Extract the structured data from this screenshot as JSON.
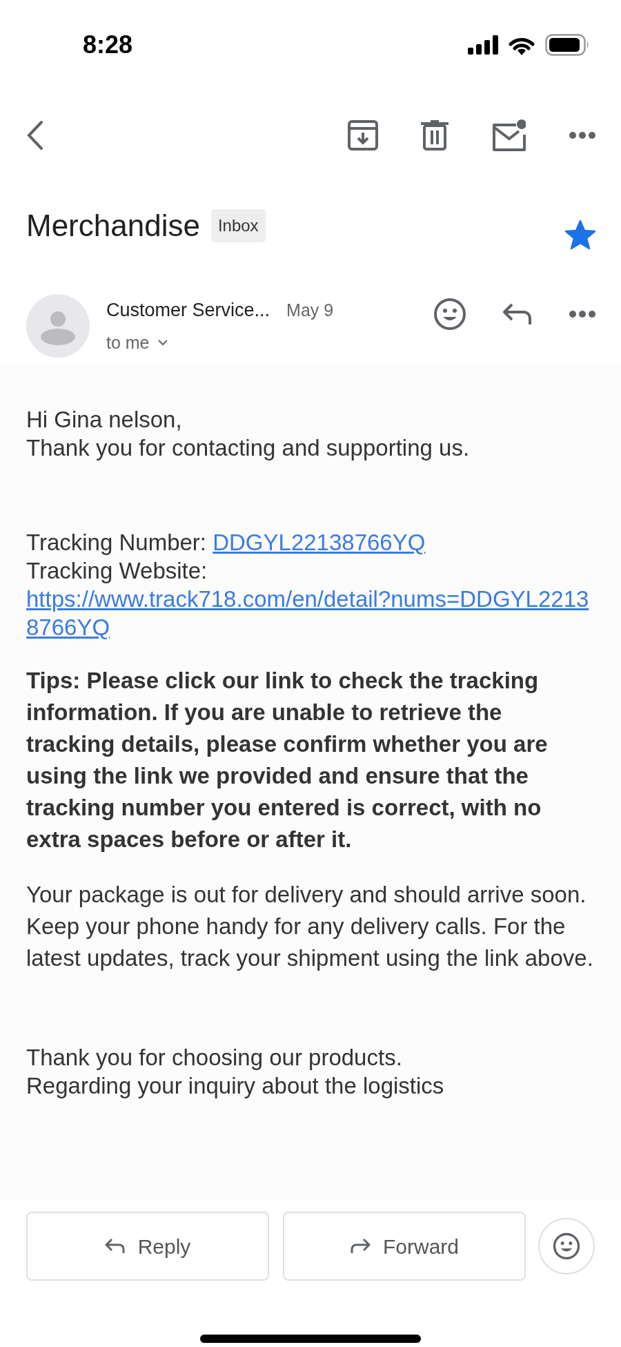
{
  "status_bar": {
    "time": "8:28"
  },
  "subject": {
    "title": "Merchandise",
    "label": "Inbox",
    "starred": true
  },
  "message": {
    "sender": "Customer Service...",
    "date": "May 9",
    "recipient": "to me"
  },
  "body": [
    {
      "kind": "lines",
      "lines": [
        "Hi Gina nelson,",
        "Thank you for contacting and supporting us."
      ]
    },
    {
      "kind": "field",
      "label": "Tracking Number:",
      "link": "DDGYL22138766YQ"
    },
    {
      "kind": "field",
      "label": "Tracking Website:",
      "link": "https://www.track718.com/en/detail?nums=DDGYL22138766YQ"
    },
    {
      "kind": "bold",
      "text": "Tips: Please click our link to check the tracking information. If you are unable to retrieve the tracking details, please confirm whether you are using the link we provided and ensure that the tracking number you entered is correct, with no extra spaces before or after it."
    },
    {
      "kind": "text",
      "text": "Your package is out for delivery and should arrive soon. Keep your phone handy for any delivery calls. For the latest updates, track your shipment using the link above."
    },
    {
      "kind": "lines",
      "lines": [
        "Thank you for choosing our products.",
        "Regarding your inquiry about the logistics"
      ]
    }
  ],
  "actions": [
    {
      "kind": "reply",
      "label": "Reply"
    },
    {
      "kind": "forward",
      "label": "Forward"
    }
  ]
}
